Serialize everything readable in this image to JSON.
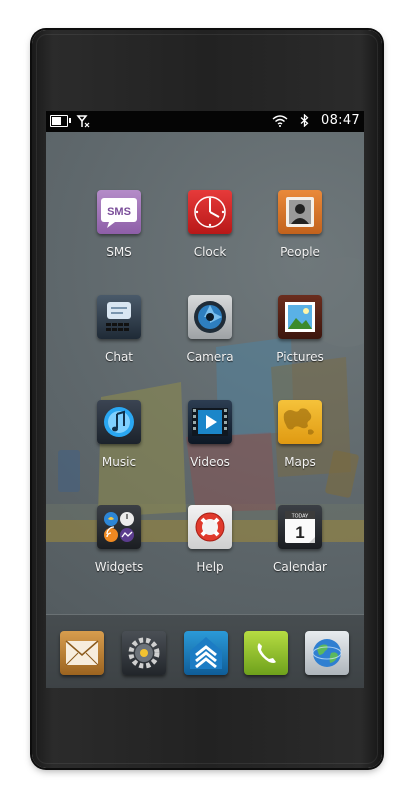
{
  "status_bar": {
    "time": "08:47",
    "icons": [
      "battery-icon",
      "signal-off-icon",
      "wifi-icon",
      "bluetooth-icon"
    ]
  },
  "apps": [
    {
      "label": "SMS",
      "icon": "sms-icon",
      "icon_text": "SMS"
    },
    {
      "label": "Clock",
      "icon": "clock-icon"
    },
    {
      "label": "People",
      "icon": "people-icon"
    },
    {
      "label": "Chat",
      "icon": "chat-icon"
    },
    {
      "label": "Camera",
      "icon": "camera-icon"
    },
    {
      "label": "Pictures",
      "icon": "pictures-icon"
    },
    {
      "label": "Music",
      "icon": "music-icon"
    },
    {
      "label": "Videos",
      "icon": "videos-icon"
    },
    {
      "label": "Maps",
      "icon": "maps-icon"
    },
    {
      "label": "Widgets",
      "icon": "widgets-icon"
    },
    {
      "label": "Help",
      "icon": "help-icon"
    },
    {
      "label": "Calendar",
      "icon": "calendar-icon",
      "icon_text": "TODAY",
      "icon_number": "1"
    }
  ],
  "dock": [
    "email-icon",
    "settings-icon",
    "launcher-icon",
    "phone-icon",
    "browser-icon"
  ]
}
